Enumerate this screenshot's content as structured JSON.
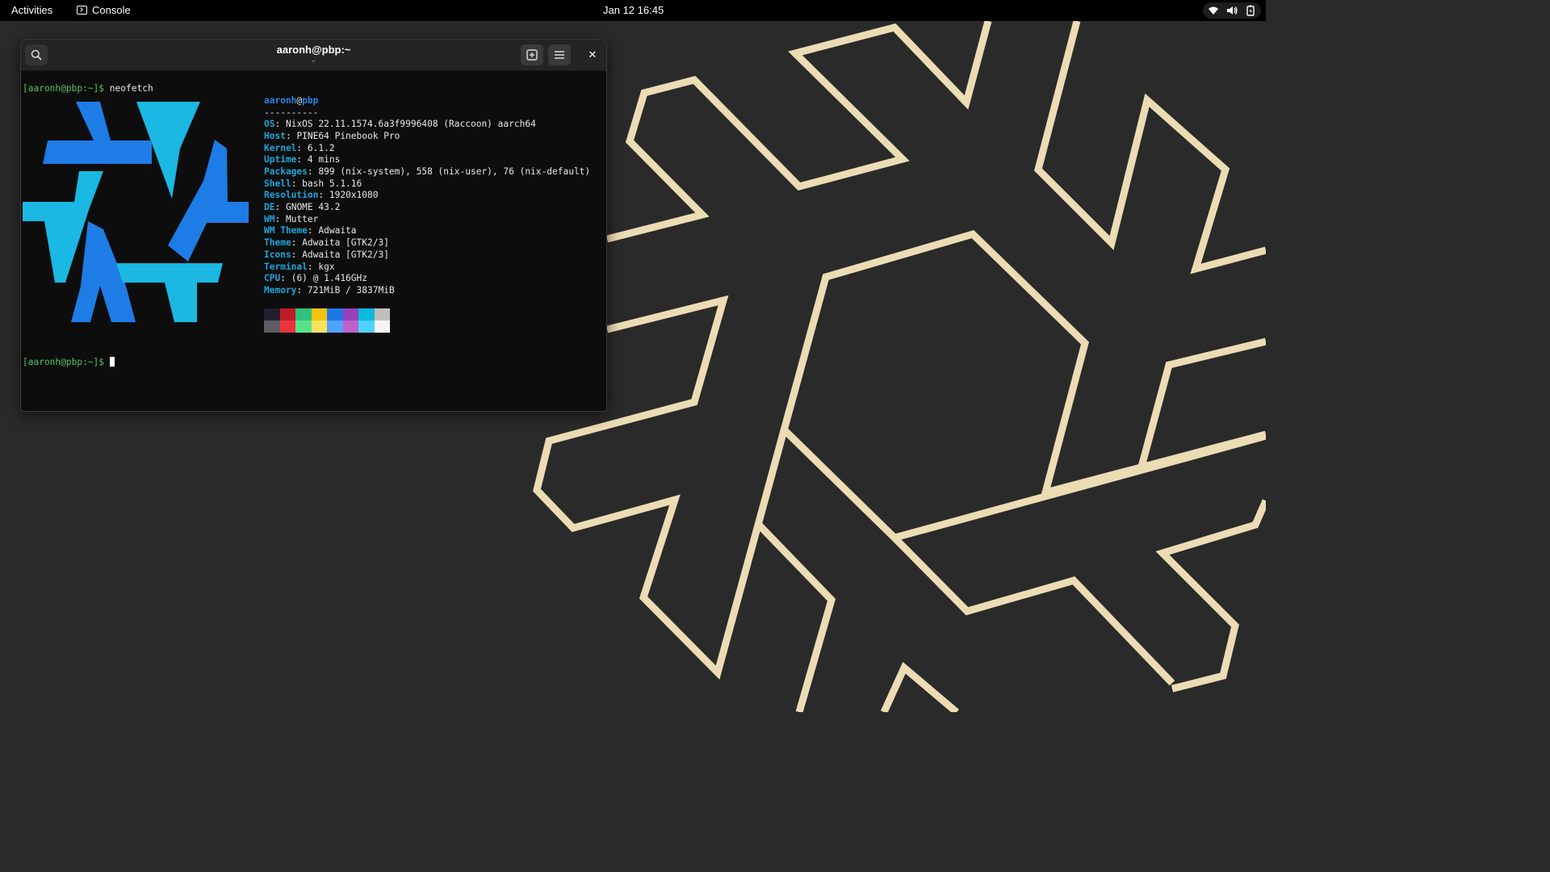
{
  "topbar": {
    "activities": "Activities",
    "app_name": "Console",
    "clock": "Jan 12  16:45",
    "status_icons": [
      "wifi-icon",
      "volume-icon",
      "battery-icon"
    ]
  },
  "terminal": {
    "title": "aaronh@pbp:~",
    "title_sub": "⌄",
    "close_glyph": "✕",
    "command_prompt": "[aaronh@pbp:~]$",
    "command": "neofetch",
    "final_prompt": "[aaronh@pbp:~]$",
    "neofetch": {
      "user": "aaronh",
      "at": "@",
      "host": "pbp",
      "separator": "----------",
      "info": [
        {
          "key": "OS",
          "value": "NixOS 22.11.1574.6a3f9996408 (Raccoon) aarch64"
        },
        {
          "key": "Host",
          "value": "PINE64 Pinebook Pro"
        },
        {
          "key": "Kernel",
          "value": "6.1.2"
        },
        {
          "key": "Uptime",
          "value": "4 mins"
        },
        {
          "key": "Packages",
          "value": "899 (nix-system), 558 (nix-user), 76 (nix-default)"
        },
        {
          "key": "Shell",
          "value": "bash 5.1.16"
        },
        {
          "key": "Resolution",
          "value": "1920x1080"
        },
        {
          "key": "DE",
          "value": "GNOME 43.2"
        },
        {
          "key": "WM",
          "value": "Mutter"
        },
        {
          "key": "WM Theme",
          "value": "Adwaita"
        },
        {
          "key": "Theme",
          "value": "Adwaita [GTK2/3]"
        },
        {
          "key": "Icons",
          "value": "Adwaita [GTK2/3]"
        },
        {
          "key": "Terminal",
          "value": "kgx"
        },
        {
          "key": "CPU",
          "value": "(6) @ 1.416GHz"
        },
        {
          "key": "Memory",
          "value": "721MiB / 3837MiB"
        }
      ],
      "palette_top": [
        "#241f31",
        "#c01c28",
        "#2ec27e",
        "#f5c211",
        "#1e78e4",
        "#9841bb",
        "#0ab9dc",
        "#c0bfbc"
      ],
      "palette_bottom": [
        "#5e5c64",
        "#ed333b",
        "#57e389",
        "#f8e45c",
        "#51a1ff",
        "#c061cb",
        "#4fd2fd",
        "#f6f5f4"
      ]
    }
  },
  "colors": {
    "logo_light": "#1ab8e2",
    "logo_dark": "#1e7ce6",
    "wallpaper_line": "#ecdcb4"
  }
}
